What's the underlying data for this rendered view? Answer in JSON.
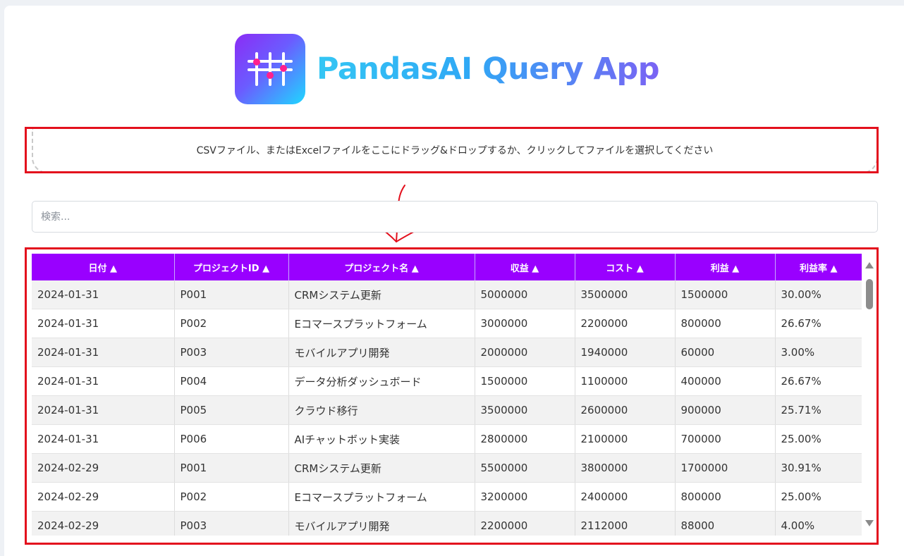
{
  "header": {
    "title": "PandasAI Query App",
    "logo_icon": "sliders-icon"
  },
  "dropzone": {
    "text": "CSVファイル、またはExcelファイルをここにドラッグ&ドロップするか、クリックしてファイルを選択してください"
  },
  "search": {
    "placeholder": "検索...",
    "value": ""
  },
  "table": {
    "headers": [
      "日付 ▲",
      "プロジェクトID ▲",
      "プロジェクト名 ▲",
      "収益 ▲",
      "コスト ▲",
      "利益 ▲",
      "利益率 ▲"
    ],
    "rows": [
      [
        "2024-01-31",
        "P001",
        "CRMシステム更新",
        "5000000",
        "3500000",
        "1500000",
        "30.00%"
      ],
      [
        "2024-01-31",
        "P002",
        "Eコマースプラットフォーム",
        "3000000",
        "2200000",
        "800000",
        "26.67%"
      ],
      [
        "2024-01-31",
        "P003",
        "モバイルアプリ開発",
        "2000000",
        "1940000",
        "60000",
        "3.00%"
      ],
      [
        "2024-01-31",
        "P004",
        "データ分析ダッシュボード",
        "1500000",
        "1100000",
        "400000",
        "26.67%"
      ],
      [
        "2024-01-31",
        "P005",
        "クラウド移行",
        "3500000",
        "2600000",
        "900000",
        "25.71%"
      ],
      [
        "2024-01-31",
        "P006",
        "AIチャットボット実装",
        "2800000",
        "2100000",
        "700000",
        "25.00%"
      ],
      [
        "2024-02-29",
        "P001",
        "CRMシステム更新",
        "5500000",
        "3800000",
        "1700000",
        "30.91%"
      ],
      [
        "2024-02-29",
        "P002",
        "Eコマースプラットフォーム",
        "3200000",
        "2400000",
        "800000",
        "25.00%"
      ],
      [
        "2024-02-29",
        "P003",
        "モバイルアプリ開発",
        "2200000",
        "2112000",
        "88000",
        "4.00%"
      ]
    ]
  },
  "colors": {
    "header_bg": "#9900ff",
    "annotation_red": "#e3101d",
    "title_gradient_start": "#34c6f4",
    "title_gradient_end": "#7a63f4"
  }
}
